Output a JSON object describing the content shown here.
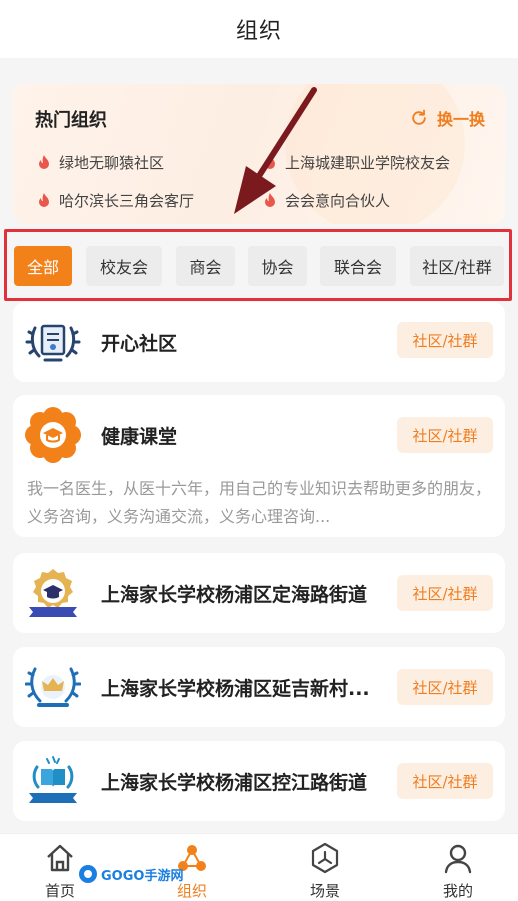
{
  "header": {
    "title": "组织"
  },
  "hot": {
    "title": "热门组织",
    "refresh_label": "换一换",
    "items": [
      "绿地无聊猿社区",
      "上海城建职业学院校友会",
      "哈尔滨长三角会客厅",
      "会会意向合伙人"
    ]
  },
  "tabs": [
    "全部",
    "校友会",
    "商会",
    "协会",
    "联合会",
    "社区/社群"
  ],
  "cards": [
    {
      "name": "开心社区",
      "tag": "社区/社群",
      "icon": "laurel-certificate-icon"
    },
    {
      "name": "健康课堂",
      "tag": "社区/社群",
      "icon": "graduation-cap-flower-icon",
      "description": "我一名医生，从医十六年，用自己的专业知识去帮助更多的朋友，义务咨询，义务沟通交流，义务心理咨询..."
    },
    {
      "name": "上海家长学校杨浦区定海路街道",
      "tag": "社区/社群",
      "icon": "graduation-ribbon-icon"
    },
    {
      "name": "上海家长学校杨浦区延吉新村...",
      "tag": "社区/社群",
      "icon": "crown-laurel-icon"
    },
    {
      "name": "上海家长学校杨浦区控江路街道",
      "tag": "社区/社群",
      "icon": "book-ribbon-icon"
    }
  ],
  "bottom_nav": [
    {
      "label": "首页",
      "icon": "home-icon"
    },
    {
      "label": "组织",
      "icon": "organization-icon"
    },
    {
      "label": "场景",
      "icon": "scene-icon"
    },
    {
      "label": "我的",
      "icon": "user-icon"
    }
  ],
  "watermark": "GOGO手游网",
  "colors": {
    "accent": "#f28119",
    "highlight_frame": "#e0323a",
    "tag_bg": "#fdeee2"
  }
}
